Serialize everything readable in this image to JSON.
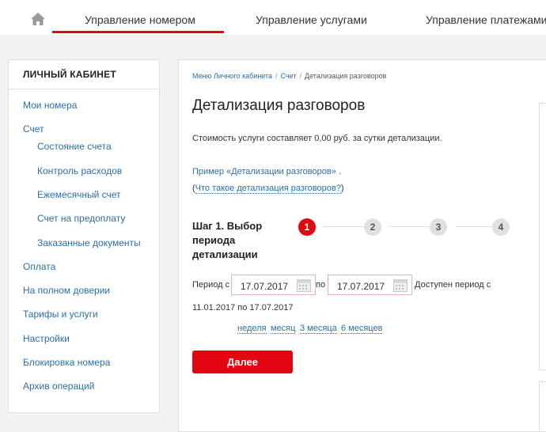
{
  "topnav": {
    "home_icon": "home-icon",
    "items": [
      "Управление номером",
      "Управление услугами",
      "Управление платежами"
    ]
  },
  "sidebar": {
    "title": "ЛИЧНЫЙ КАБИНЕТ",
    "items": [
      "Мои номера",
      "Счет",
      "Состояние счета",
      "Контроль расходов",
      "Ежемесячный счет",
      "Счет на предоплату",
      "Заказанные документы",
      "Оплата",
      "На полном доверии",
      "Тарифы и услуги",
      "Настройки",
      "Блокировка номера",
      "Архив операций"
    ]
  },
  "breadcrumbs": [
    "Меню Личного кабинета",
    "Счет",
    "Детализация разговоров"
  ],
  "page": {
    "title": "Детализация разговоров",
    "cost_text": "Стоимость услуги составляет 0,00 руб. за сутки детализации.",
    "example_link": "Пример «Детализации разговоров» .",
    "whatis_open": "(",
    "whatis_link": "Что такое детализация разговоров?",
    "whatis_close": ")"
  },
  "steps": {
    "label": "Шаг 1. Выбор периода детализации",
    "numbers": [
      "1",
      "2",
      "3",
      "4"
    ],
    "active": 1
  },
  "period": {
    "from_label": "Период с",
    "from_value": "17.07.2017",
    "to_label": "по",
    "to_value": "17.07.2017",
    "available_line1": "Доступен период с",
    "available_line2": "11.01.2017 по 17.07.2017",
    "quick": [
      "неделя",
      "месяц",
      "3 месяца",
      "6 месяцев"
    ]
  },
  "next_button": "Далее",
  "colors": {
    "accent": "#e30611",
    "link": "#2a6fa8"
  }
}
